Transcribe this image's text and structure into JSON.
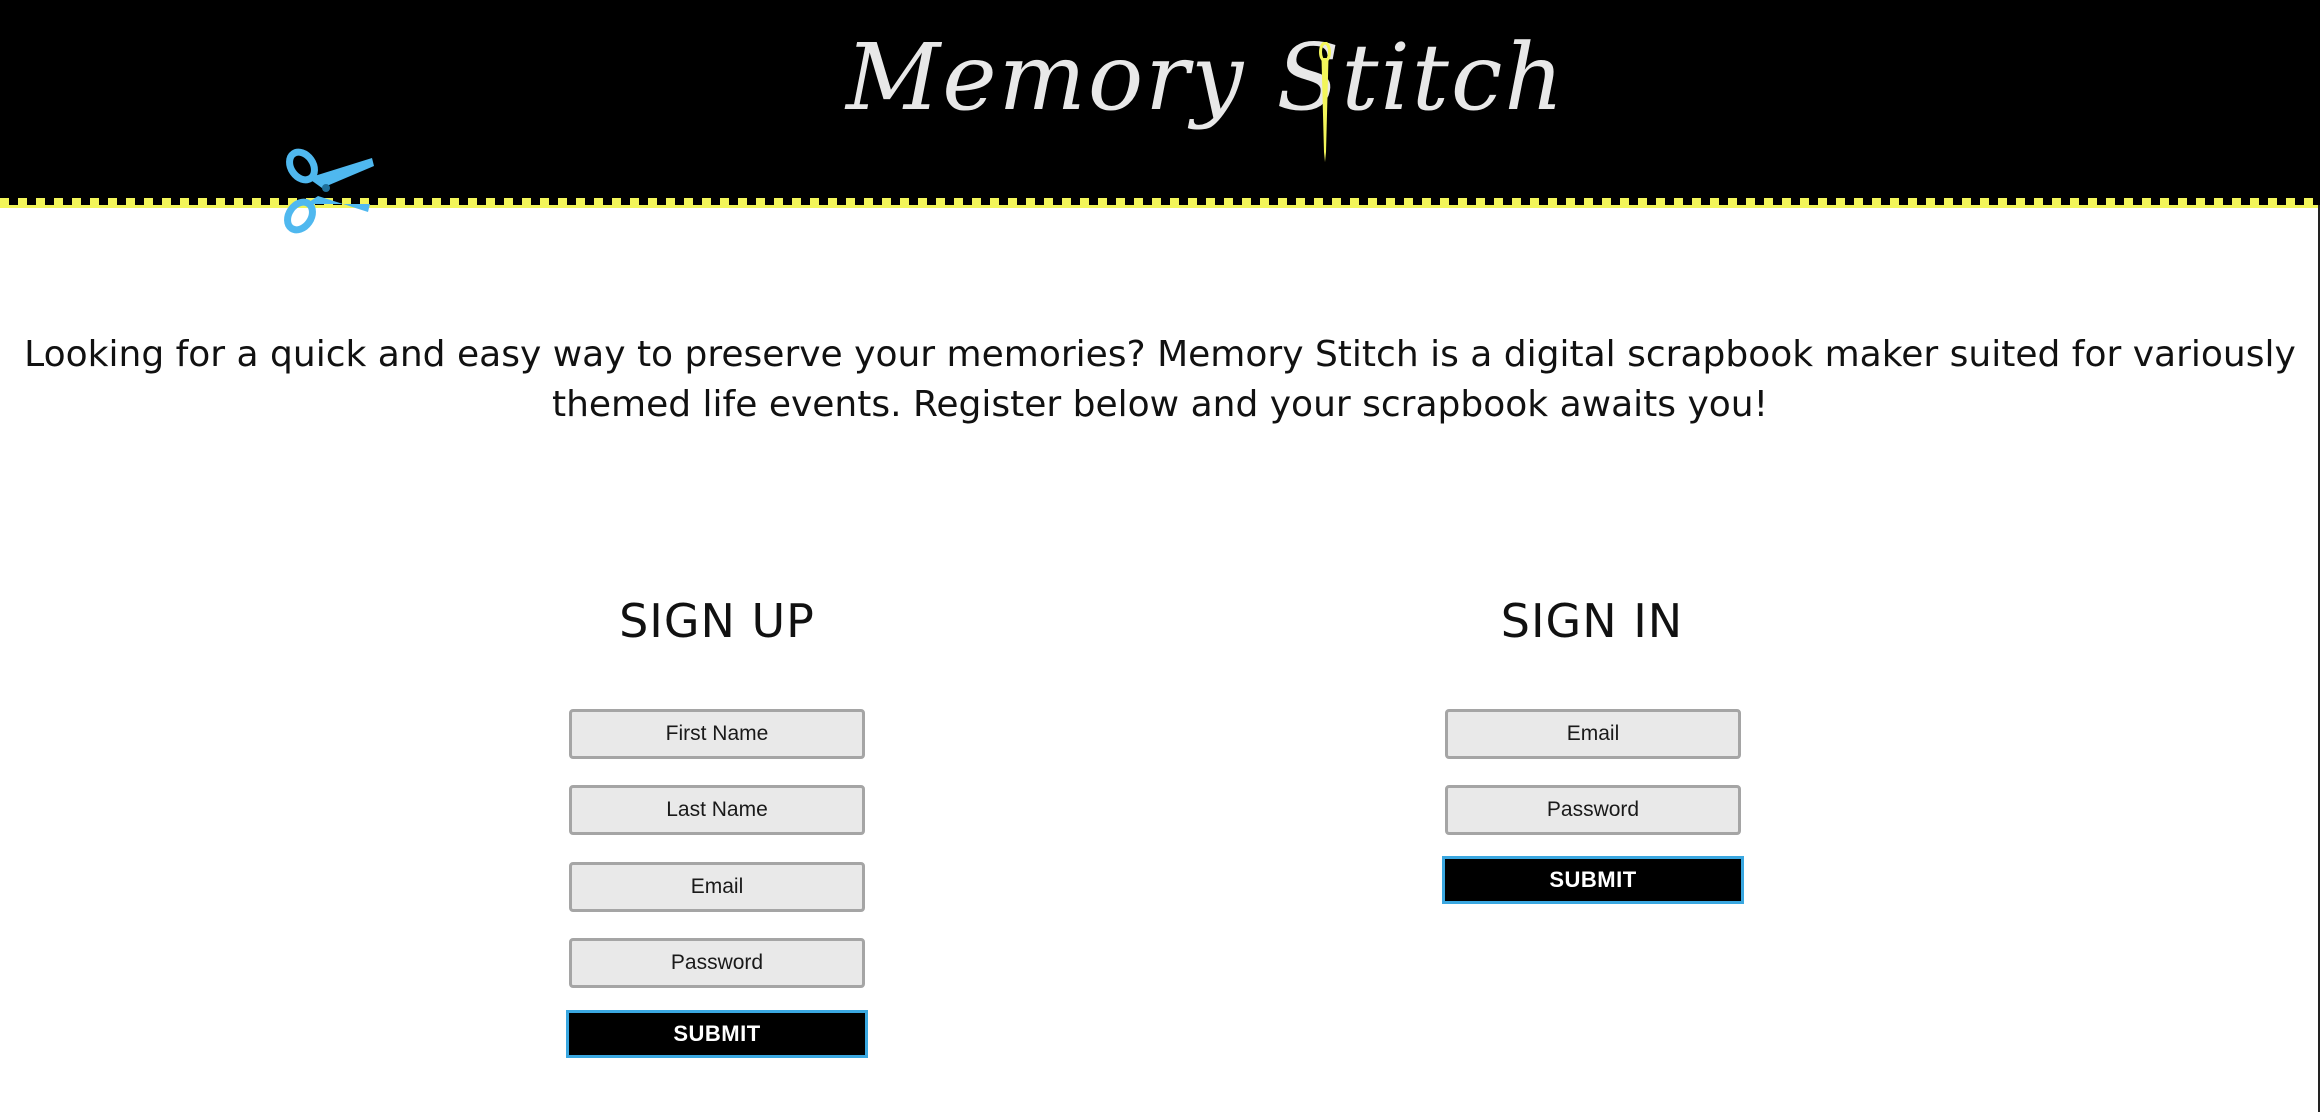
{
  "header": {
    "logo_text": "Memory Stitch",
    "colors": {
      "background": "#000000",
      "stitch": "#f2f55a",
      "scissors": "#4fb8ef",
      "needle": "#f2f55a"
    },
    "icons": [
      "scissors-icon",
      "needle-icon"
    ]
  },
  "intro": {
    "text": "Looking for a quick and easy way to preserve your memories? Memory Stitch is a digital scrapbook maker suited for variously themed life events. Register below and your scrapbook awaits you!"
  },
  "signup": {
    "title": "SIGN UP",
    "first_name_placeholder": "First Name",
    "last_name_placeholder": "Last Name",
    "email_placeholder": "Email",
    "password_placeholder": "Password",
    "submit_label": "SUBMIT"
  },
  "signin": {
    "title": "SIGN IN",
    "email_placeholder": "Email",
    "password_placeholder": "Password",
    "submit_label": "SUBMIT"
  },
  "colors": {
    "button_bg": "#000000",
    "button_border": "#3aa7e0",
    "input_bg": "#e9e9e9",
    "input_border": "#a5a5a5"
  }
}
